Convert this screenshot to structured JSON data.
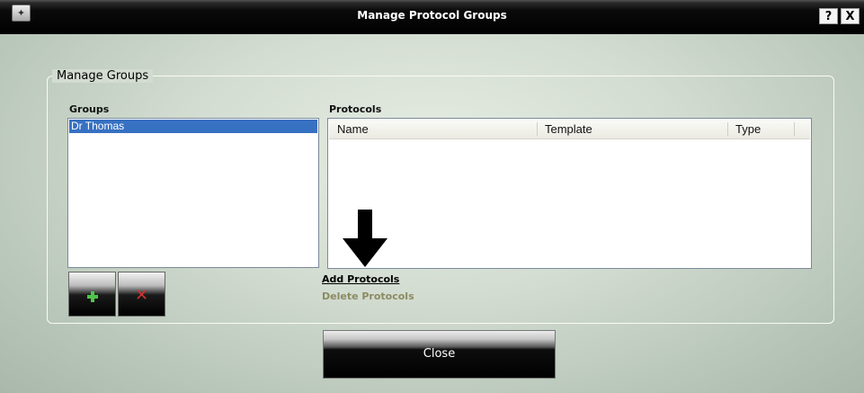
{
  "window": {
    "title": "Manage Protocol Groups",
    "app_icon": "app-logo-icon",
    "help_label": "?",
    "close_label": "X"
  },
  "manage_groups": {
    "legend": "Manage Groups",
    "groups_label": "Groups",
    "groups": [
      "Dr Thomas"
    ],
    "selected_group": "Dr Thomas",
    "protocols_label": "Protocols",
    "protocols_columns": [
      "Name",
      "Template",
      "Type"
    ],
    "protocols_rows": []
  },
  "actions": {
    "add_group_icon": "plus-icon",
    "remove_group_icon": "x-icon",
    "add_protocols": "Add Protocols",
    "delete_protocols": "Delete Protocols",
    "close": "Close"
  },
  "colors": {
    "selection": "#3771c2",
    "add_green": "#4ec64a",
    "remove_red": "#cc3333",
    "disabled_link": "#8b8b62"
  }
}
